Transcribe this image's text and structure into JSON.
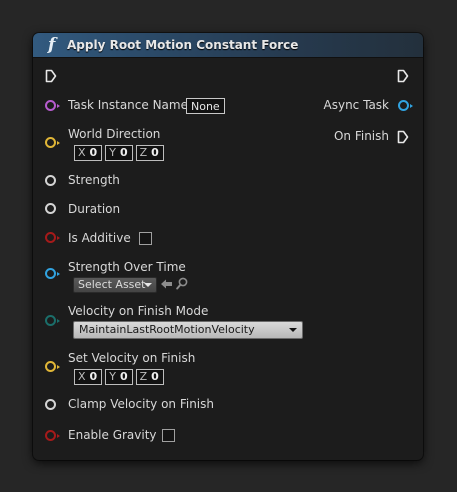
{
  "node": {
    "title": "Apply Root Motion Constant Force",
    "icon": "function-icon",
    "header_color": "#2b4a68"
  },
  "inputs": {
    "task_instance_name": {
      "label": "Task Instance Name",
      "value": "None",
      "pin_color": "#b75ccf"
    },
    "world_direction": {
      "label": "World Direction",
      "x_axis": "X",
      "x": "0",
      "y_axis": "Y",
      "y": "0",
      "z_axis": "Z",
      "z": "0",
      "pin_color": "#e0b637"
    },
    "strength": {
      "label": "Strength",
      "pin_color": "#d4d4d4"
    },
    "duration": {
      "label": "Duration",
      "pin_color": "#d4d4d4"
    },
    "is_additive": {
      "label": "Is Additive",
      "checked": false,
      "pin_color": "#a51a1a"
    },
    "strength_over_time": {
      "label": "Strength Over Time",
      "asset_placeholder": "Select Asset",
      "pin_color": "#31a3e0"
    },
    "velocity_on_finish_mode": {
      "label": "Velocity on Finish Mode",
      "value": "MaintainLastRootMotionVelocity",
      "pin_color": "#1b6e6a"
    },
    "set_velocity_on_finish": {
      "label": "Set Velocity on Finish",
      "x_axis": "X",
      "x": "0",
      "y_axis": "Y",
      "y": "0",
      "z_axis": "Z",
      "z": "0",
      "pin_color": "#e0b637"
    },
    "clamp_velocity_on_finish": {
      "label": "Clamp Velocity on Finish",
      "pin_color": "#d4d4d4"
    },
    "enable_gravity": {
      "label": "Enable Gravity",
      "checked": false,
      "pin_color": "#a51a1a"
    }
  },
  "outputs": {
    "async_task": {
      "label": "Async Task",
      "pin_color": "#31a3e0"
    },
    "on_finish": {
      "label": "On Finish"
    }
  }
}
